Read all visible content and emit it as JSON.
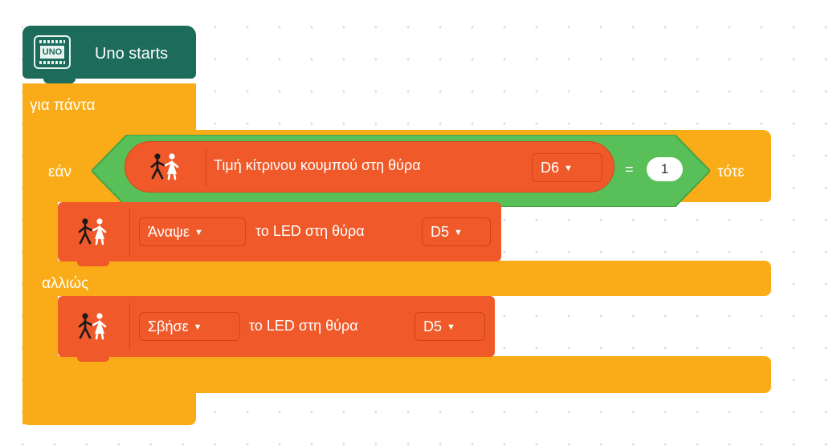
{
  "hat": {
    "board_label": "UNO",
    "title": "Uno starts"
  },
  "forever": {
    "label": "για πάντα"
  },
  "if_else": {
    "if_label": "εάν",
    "then_label": "τότε",
    "else_label": "αλλιώς"
  },
  "condition": {
    "reporter_text": "Τιμή κίτρινου κουμπού στη θύρα",
    "port": "D6",
    "operator": "=",
    "value": "1"
  },
  "then_block": {
    "action": "Άναψε",
    "text": "το LED στη θύρα",
    "port": "D5"
  },
  "else_block": {
    "action": "Σβήσε",
    "text": "το LED στη θύρα",
    "port": "D5"
  },
  "colors": {
    "hat": "#1d6b5b",
    "control": "#f9ac18",
    "operator": "#59c059",
    "extension": "#f05a2a"
  },
  "icons": {
    "hat_icon": "arduino-uno-board-icon",
    "block_icon": "two-figures-icon",
    "dropdown_icon": "caret-down-icon"
  }
}
